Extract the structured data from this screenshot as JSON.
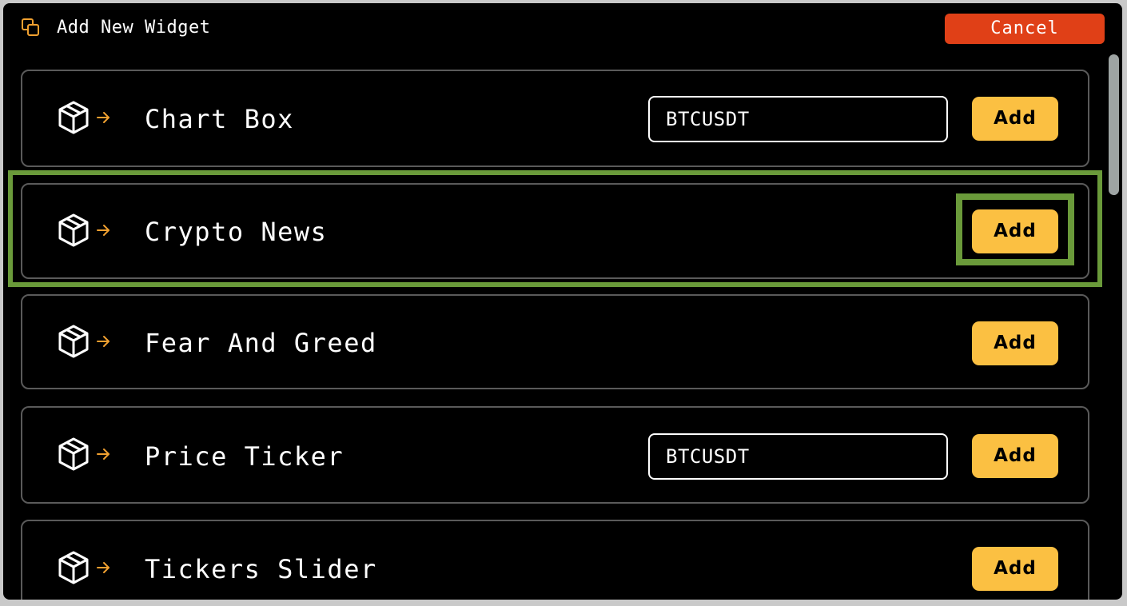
{
  "header": {
    "title": "Add New Widget",
    "icon": "copy-icon",
    "cancel_label": "Cancel"
  },
  "widgets": [
    {
      "label": "Chart Box",
      "icon": "box-arrow-icon",
      "input_value": "BTCUSDT",
      "add_label": "Add"
    },
    {
      "label": "Crypto News",
      "icon": "box-arrow-icon",
      "add_label": "Add"
    },
    {
      "label": "Fear And Greed",
      "icon": "box-arrow-icon",
      "add_label": "Add"
    },
    {
      "label": "Price Ticker",
      "icon": "box-arrow-icon",
      "input_value": "BTCUSDT",
      "add_label": "Add"
    },
    {
      "label": "Tickers Slider",
      "icon": "box-arrow-icon",
      "add_label": "Add"
    }
  ],
  "colors": {
    "background": "#000000",
    "cancel": "#e04017",
    "add": "#fbc042",
    "accent_arrow": "#f0a030",
    "highlight": "#6a9a3a"
  }
}
